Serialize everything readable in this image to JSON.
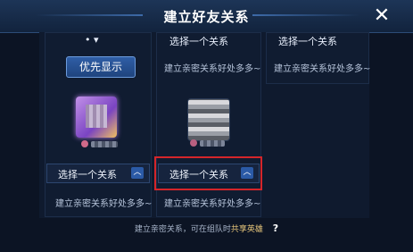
{
  "header": {
    "title": "建立好友关系",
    "close_icon": "close-icon"
  },
  "slots": {
    "top_left_fragment": "• ▾",
    "top_mid_label": "选择一个关系",
    "top_right_label": "选择一个关系",
    "top_mid_hint": "建立亲密关系好处多多~",
    "top_right_hint": "建立亲密关系好处多多~",
    "priority_label": "优先显示",
    "select_left_label": "选择一个关系",
    "select_mid_label": "选择一个关系",
    "hint_left": "建立亲密关系好处多多~",
    "hint_mid": "建立亲密关系好处多多~"
  },
  "footer": {
    "text": "建立亲密关系，可在组队时",
    "accent": "共享英雄",
    "help_icon": "?"
  },
  "colors": {
    "highlight": "#d5252a",
    "accent": "#e8c77c",
    "button": "#2b5aa6"
  }
}
